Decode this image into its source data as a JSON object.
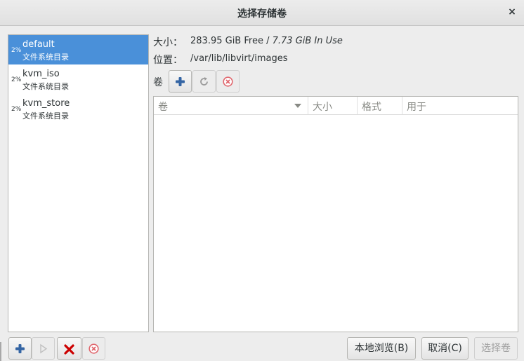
{
  "window": {
    "title": "选择存储卷",
    "close_glyph": "×"
  },
  "pools": [
    {
      "percent": "2%",
      "name": "default",
      "type": "文件系统目录",
      "selected": true
    },
    {
      "percent": "2%",
      "name": "kvm_iso",
      "type": "文件系统目录",
      "selected": false
    },
    {
      "percent": "2%",
      "name": "kvm_store",
      "type": "文件系统目录",
      "selected": false
    }
  ],
  "pool_info": {
    "size_label": "大小：",
    "size_value": "283.95 GiB Free / ",
    "size_in_use": "7.73 GiB In Use",
    "location_label": "位置：",
    "location_value": "/var/lib/libvirt/images"
  },
  "volumes": {
    "label": "卷",
    "toolbar_icons": [
      "add-icon",
      "refresh-icon",
      "delete-icon"
    ],
    "columns": [
      "卷",
      "大小",
      "格式",
      "用于"
    ],
    "rows": []
  },
  "bottom_icons": [
    "add-pool-icon",
    "start-pool-icon",
    "stop-pool-icon",
    "delete-pool-icon"
  ],
  "buttons": {
    "browse_local": "本地浏览(B)",
    "cancel": "取消(C)",
    "choose_volume": "选择卷"
  },
  "colors": {
    "selection": "#4a90d9",
    "add_blue": "#3465a4",
    "stop_red": "#cc0000",
    "delete_red": "#e0666d"
  }
}
